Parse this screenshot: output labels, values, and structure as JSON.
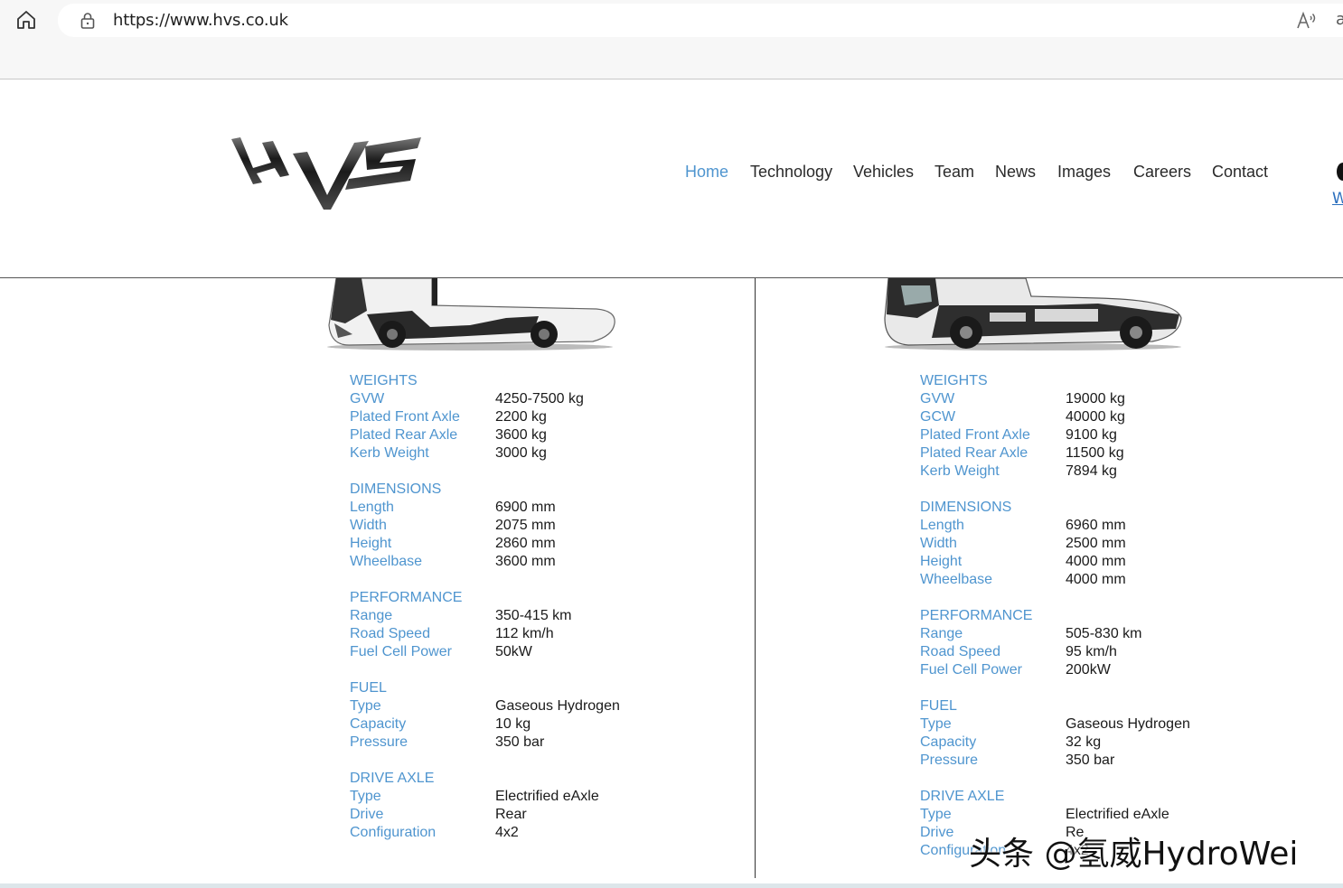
{
  "browser": {
    "url": "https://www.hvs.co.uk",
    "trailing_char": "a"
  },
  "header": {
    "logo_text": "HVS",
    "nav": [
      "Home",
      "Technology",
      "Vehicles",
      "Team",
      "News",
      "Images",
      "Careers",
      "Contact"
    ],
    "active_nav": "Home",
    "edge_link": "W"
  },
  "colors": {
    "accent": "#4f95cf",
    "text": "#1a1a1a"
  },
  "left_vehicle": {
    "sections": [
      {
        "title": "WEIGHTS",
        "rows": [
          {
            "label": "GVW",
            "value": "4250-7500 kg"
          },
          {
            "label": "Plated Front Axle",
            "value": "2200 kg"
          },
          {
            "label": "Plated Rear Axle",
            "value": "3600 kg"
          },
          {
            "label": "Kerb Weight",
            "value": "3000 kg"
          }
        ]
      },
      {
        "title": "DIMENSIONS",
        "rows": [
          {
            "label": "Length",
            "value": "6900 mm"
          },
          {
            "label": "Width",
            "value": "2075 mm"
          },
          {
            "label": "Height",
            "value": "2860 mm"
          },
          {
            "label": "Wheelbase",
            "value": "3600 mm"
          }
        ]
      },
      {
        "title": "PERFORMANCE",
        "rows": [
          {
            "label": "Range",
            "value": "350-415 km"
          },
          {
            "label": "Road Speed",
            "value": "112 km/h"
          },
          {
            "label": "Fuel Cell Power",
            "value": "50kW"
          }
        ]
      },
      {
        "title": "FUEL",
        "rows": [
          {
            "label": "Type",
            "value": "Gaseous Hydrogen"
          },
          {
            "label": "Capacity",
            "value": "10 kg"
          },
          {
            "label": "Pressure",
            "value": "350 bar"
          }
        ]
      },
      {
        "title": "DRIVE AXLE",
        "rows": [
          {
            "label": "Type",
            "value": "Electrified eAxle"
          },
          {
            "label": "Drive",
            "value": "Rear"
          },
          {
            "label": "Configuration",
            "value": "4x2"
          }
        ]
      }
    ]
  },
  "right_vehicle": {
    "sections": [
      {
        "title": "WEIGHTS",
        "rows": [
          {
            "label": "GVW",
            "value": "19000 kg"
          },
          {
            "label": "GCW",
            "value": "40000 kg"
          },
          {
            "label": "Plated Front Axle",
            "value": "9100 kg"
          },
          {
            "label": "Plated Rear Axle",
            "value": "11500 kg"
          },
          {
            "label": "Kerb Weight",
            "value": "7894 kg"
          }
        ]
      },
      {
        "title": "DIMENSIONS",
        "rows": [
          {
            "label": "Length",
            "value": "6960 mm"
          },
          {
            "label": "Width",
            "value": "2500 mm"
          },
          {
            "label": "Height",
            "value": "4000 mm"
          },
          {
            "label": "Wheelbase",
            "value": "4000 mm"
          }
        ]
      },
      {
        "title": "PERFORMANCE",
        "rows": [
          {
            "label": "Range",
            "value": "505-830 km"
          },
          {
            "label": "Road Speed",
            "value": "95 km/h"
          },
          {
            "label": "Fuel Cell Power",
            "value": "200kW"
          }
        ]
      },
      {
        "title": "FUEL",
        "rows": [
          {
            "label": "Type",
            "value": "Gaseous Hydrogen"
          },
          {
            "label": "Capacity",
            "value": "32 kg"
          },
          {
            "label": "Pressure",
            "value": "350 bar"
          }
        ]
      },
      {
        "title": "DRIVE AXLE",
        "rows": [
          {
            "label": "Type",
            "value": "Electrified eAxle"
          },
          {
            "label": "Drive",
            "value": "Re"
          },
          {
            "label": "Configuration",
            "value": "4x2"
          }
        ]
      }
    ]
  },
  "watermark": "头条 @氢威HydroWei"
}
